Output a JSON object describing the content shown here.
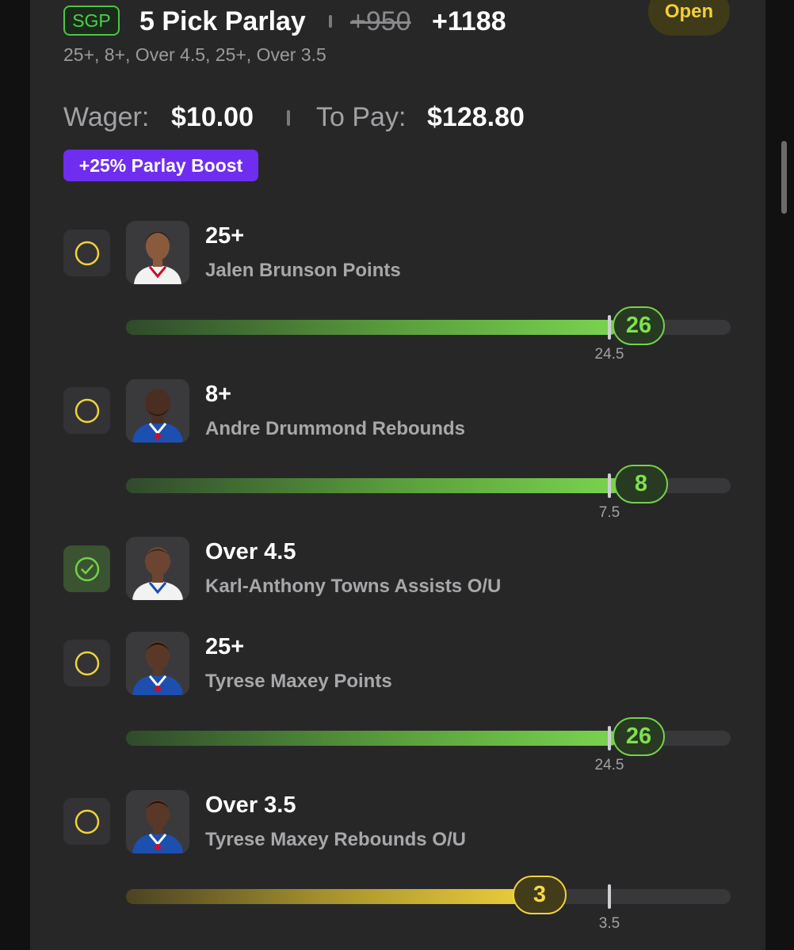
{
  "header": {
    "badge": "SGP",
    "title": "5 Pick Parlay",
    "odds_original": "+950",
    "odds_boosted": "+1188",
    "status": "Open",
    "subtitle": "25+, 8+, Over 4.5, 25+, Over 3.5"
  },
  "wager": {
    "wager_label": "Wager:",
    "wager_value": "$10.00",
    "pay_label": "To Pay:",
    "pay_value": "$128.80"
  },
  "boost": "+25% Parlay Boost",
  "colors": {
    "accent_green": "#74d14b",
    "accent_yellow": "#f0d23c",
    "boost_purple": "#6f2df0",
    "card_bg": "#272728"
  },
  "legs": [
    {
      "line": "25+",
      "description": "Jalen Brunson Points",
      "status_icon": "open-circle-icon",
      "progress": {
        "current": "26",
        "target": "24.5",
        "color": "green"
      }
    },
    {
      "line": "8+",
      "description": "Andre Drummond Rebounds",
      "status_icon": "open-circle-icon",
      "progress": {
        "current": "8",
        "target": "7.5",
        "color": "green"
      }
    },
    {
      "line": "Over 4.5",
      "description": "Karl-Anthony Towns Assists O/U",
      "status_icon": "checkmark-circle-icon"
    },
    {
      "line": "25+",
      "description": "Tyrese Maxey Points",
      "status_icon": "open-circle-icon",
      "progress": {
        "current": "26",
        "target": "24.5",
        "color": "green"
      }
    },
    {
      "line": "Over 3.5",
      "description": "Tyrese Maxey Rebounds O/U",
      "status_icon": "open-circle-icon",
      "progress": {
        "current": "3",
        "target": "3.5",
        "color": "yellow"
      }
    }
  ]
}
